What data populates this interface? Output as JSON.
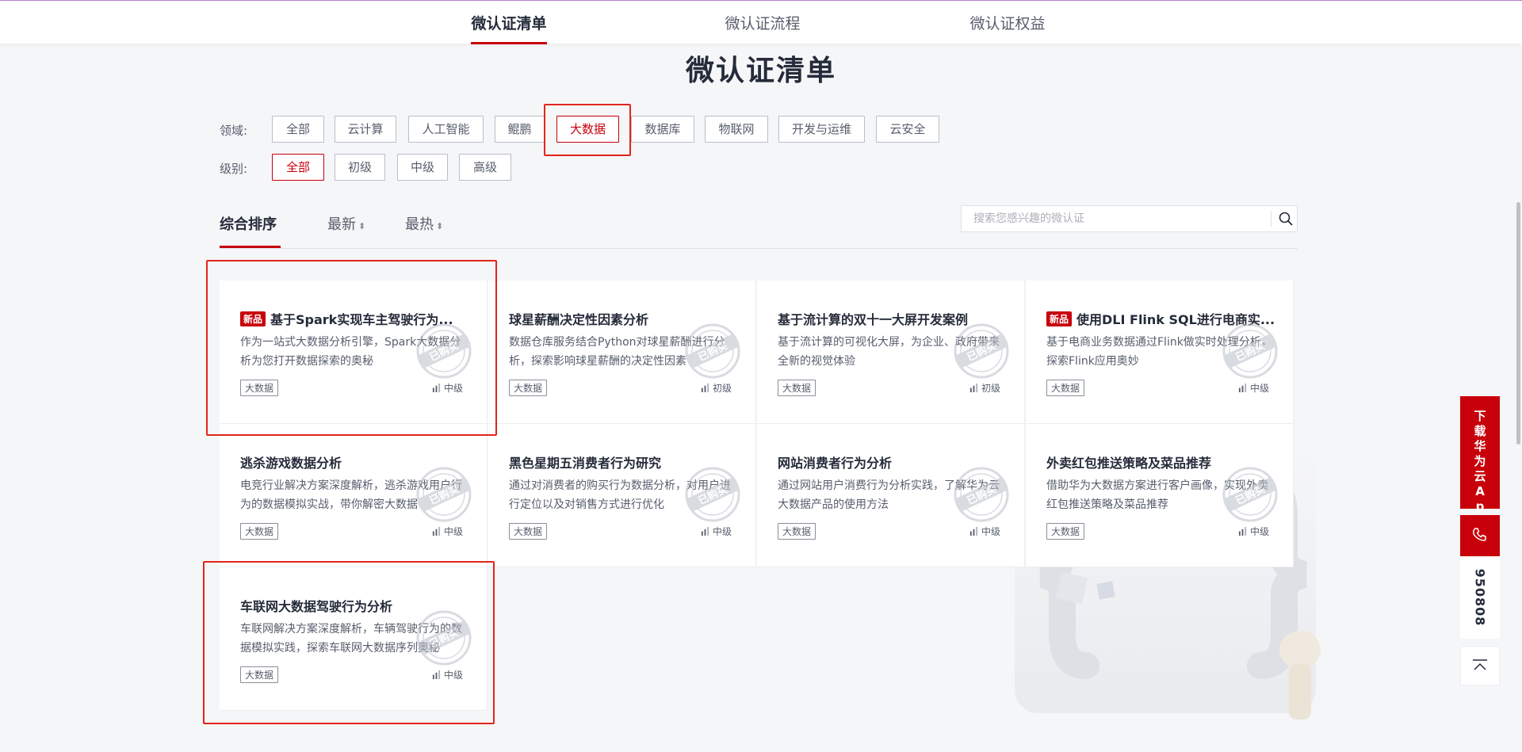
{
  "top_tabs": [
    {
      "label": "微认证清单",
      "active": true
    },
    {
      "label": "微认证流程",
      "active": false
    },
    {
      "label": "微认证权益",
      "active": false
    }
  ],
  "page_title": "微认证清单",
  "filters": {
    "domain_label": "领域:",
    "domains": [
      "全部",
      "云计算",
      "人工智能",
      "鲲鹏",
      "大数据",
      "数据库",
      "物联网",
      "开发与运维",
      "云安全"
    ],
    "domain_active": "大数据",
    "level_label": "级别:",
    "levels": [
      "全部",
      "初级",
      "中级",
      "高级"
    ],
    "level_active": "全部"
  },
  "sort": {
    "options": [
      "综合排序",
      "最新",
      "最热"
    ],
    "active": "综合排序"
  },
  "search": {
    "placeholder": "搜索您感兴趣的微认证"
  },
  "cards": [
    {
      "badge": "新品",
      "title": "基于Spark实现车主驾驶行为...",
      "desc": "作为一站式大数据分析引擎，Spark大数据分析为您打开数据探索的奥秘",
      "tag": "大数据",
      "level": "中级"
    },
    {
      "badge": "",
      "title": "球星薪酬决定性因素分析",
      "desc": "数据仓库服务结合Python对球星薪酬进行分析，探索影响球星薪酬的决定性因素",
      "tag": "大数据",
      "level": "初级"
    },
    {
      "badge": "",
      "title": "基于流计算的双十一大屏开发案例",
      "desc": "基于流计算的可视化大屏，为企业、政府带来全新的视觉体验",
      "tag": "大数据",
      "level": "初级"
    },
    {
      "badge": "新品",
      "title": "使用DLI Flink SQL进行电商实...",
      "desc": "基于电商业务数据通过Flink做实时处理分析，探索Flink应用奥妙",
      "tag": "大数据",
      "level": "中级"
    },
    {
      "badge": "",
      "title": "逃杀游戏数据分析",
      "desc": "电竞行业解决方案深度解析，逃杀游戏用户行为的数据模拟实战，带你解密大数据",
      "tag": "大数据",
      "level": "中级"
    },
    {
      "badge": "",
      "title": "黑色星期五消费者行为研究",
      "desc": "通过对消费者的购买行为数据分析，对用户进行定位以及对销售方式进行优化",
      "tag": "大数据",
      "level": "中级"
    },
    {
      "badge": "",
      "title": "网站消费者行为分析",
      "desc": "通过网站用户消费行为分析实践，了解华为云大数据产品的使用方法",
      "tag": "大数据",
      "level": "中级"
    },
    {
      "badge": "",
      "title": "外卖红包推送策略及菜品推荐",
      "desc": "借助华为大数据方案进行客户画像，实现外卖红包推送策略及菜品推荐",
      "tag": "大数据",
      "level": "中级"
    },
    {
      "badge": "",
      "title": "车联网大数据驾驶行为分析",
      "desc": "车联网解决方案深度解析，车辆驾驶行为的数据模拟实践，探索车联网大数据序列奥秘",
      "tag": "大数据",
      "level": "中级"
    }
  ],
  "stamp_text": "已购买",
  "float": {
    "download_label": "下载华为云App",
    "phone_number": "950808"
  },
  "colors": {
    "accent": "#c7000b",
    "highlight": "#e1251b"
  }
}
